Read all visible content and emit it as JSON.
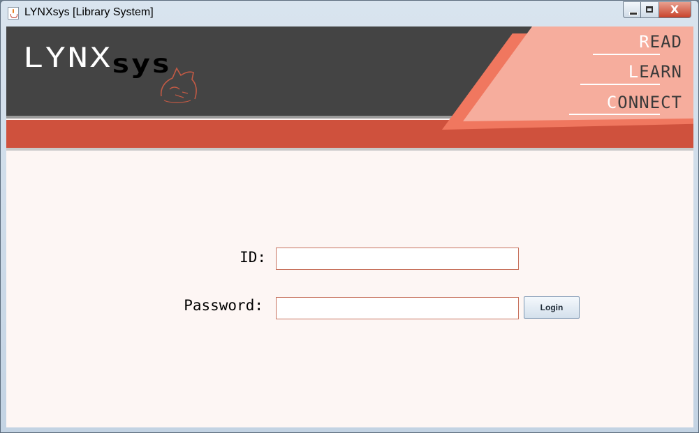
{
  "window": {
    "title": "LYNXsys [Library System]",
    "controls": [
      "minimize",
      "maximize",
      "close"
    ],
    "close_glyph": "X"
  },
  "header": {
    "logo_primary": "LYNX",
    "logo_secondary": "sys",
    "logo_icon": "cat-head-icon",
    "nav": [
      {
        "first": "R",
        "rest": "EAD"
      },
      {
        "first": "L",
        "rest": "EARN"
      },
      {
        "first": "C",
        "rest": "ONNECT"
      }
    ]
  },
  "login": {
    "id_label": "ID:",
    "id_value": "",
    "password_label": "Password:",
    "password_value": "",
    "button_label": "Login"
  },
  "colors": {
    "header_bg": "#444444",
    "accent_red": "#cf513d",
    "accent_salmon": "#f6ad9d",
    "accent_coral": "#f0775f",
    "content_bg": "#fdf6f4",
    "field_border": "#c7725e"
  }
}
